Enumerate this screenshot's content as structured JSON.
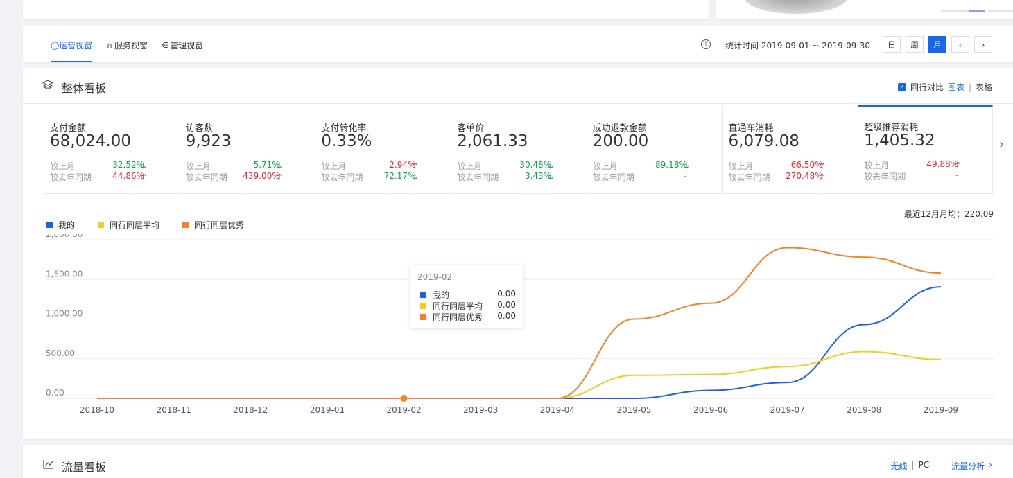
{
  "tabs": [
    {
      "label": "运营视窗",
      "active": true
    },
    {
      "label": "服务视窗",
      "active": false
    },
    {
      "label": "管理视窗",
      "active": false
    }
  ],
  "stat_period": "统计时间 2019-09-01 ~ 2019-09-30",
  "period_buttons": {
    "day": "日",
    "week": "周",
    "month": "月",
    "active": "月"
  },
  "overview": {
    "title": "整体看板",
    "compare_label": "同行对比",
    "view_chart": "图表",
    "view_table": "表格"
  },
  "metrics": [
    {
      "label": "支付金额",
      "value": "68,024.00",
      "mom": "32.52%",
      "mom_dir": "down",
      "yoy": "44.86%",
      "yoy_dir": "up"
    },
    {
      "label": "访客数",
      "value": "9,923",
      "mom": "5.71%",
      "mom_dir": "down",
      "yoy": "439.00%",
      "yoy_dir": "up"
    },
    {
      "label": "支付转化率",
      "value": "0.33%",
      "mom": "2.94%",
      "mom_dir": "up",
      "yoy": "72.17%",
      "yoy_dir": "down"
    },
    {
      "label": "客单价",
      "value": "2,061.33",
      "mom": "30.48%",
      "mom_dir": "down",
      "yoy": "3.43%",
      "yoy_dir": "down"
    },
    {
      "label": "成功退款金额",
      "value": "200.00",
      "mom": "89.18%",
      "mom_dir": "down",
      "yoy": "-",
      "yoy_dir": "none"
    },
    {
      "label": "直通车消耗",
      "value": "6,079.08",
      "mom": "66.50%",
      "mom_dir": "up",
      "yoy": "270.48%",
      "yoy_dir": "up"
    },
    {
      "label": "超级推荐消耗",
      "value": "1,405.32",
      "mom": "49.88%",
      "mom_dir": "up",
      "yoy": "-",
      "yoy_dir": "none",
      "active": true
    }
  ],
  "metric_row_labels": {
    "mom": "较上月",
    "yoy": "较去年同期"
  },
  "avg_text": "最近12月月均：220.09",
  "chart_data": {
    "type": "line",
    "smooth": true,
    "categories": [
      "2018-10",
      "2018-11",
      "2018-12",
      "2019-01",
      "2019-02",
      "2019-03",
      "2019-04",
      "2019-05",
      "2019-06",
      "2019-07",
      "2019-08",
      "2019-09"
    ],
    "series": [
      {
        "name": "我的",
        "color": "#1f5fe0",
        "values": [
          0,
          0,
          0,
          0,
          0,
          0,
          0,
          0,
          100,
          200,
          930,
          1405
        ]
      },
      {
        "name": "同行同层平均",
        "color": "#f0cd1e",
        "values": [
          0,
          0,
          0,
          0,
          0,
          0,
          0,
          290,
          300,
          400,
          590,
          490
        ]
      },
      {
        "name": "同行同层优秀",
        "color": "#f5822a",
        "values": [
          0,
          0,
          0,
          0,
          0,
          0,
          0,
          1000,
          1200,
          1900,
          1780,
          1580
        ]
      }
    ],
    "yticks": [
      "0.00",
      "500.00",
      "1,000.00",
      "1,500.00",
      "2,000.00"
    ],
    "ylim": [
      0,
      2000
    ],
    "grid": true,
    "legend": "top-left",
    "hover_index": 4
  },
  "tooltip": {
    "title": "2019-02",
    "rows": [
      {
        "name": "我的",
        "value": "0.00",
        "color": "#1f5fe0"
      },
      {
        "name": "同行同层平均",
        "value": "0.00",
        "color": "#f0cd1e"
      },
      {
        "name": "同行同层优秀",
        "value": "0.00",
        "color": "#f5822a"
      }
    ]
  },
  "flow": {
    "title": "流量看板",
    "link_wireless": "无线",
    "link_pc": "PC",
    "link_analysis": "流量分析"
  }
}
